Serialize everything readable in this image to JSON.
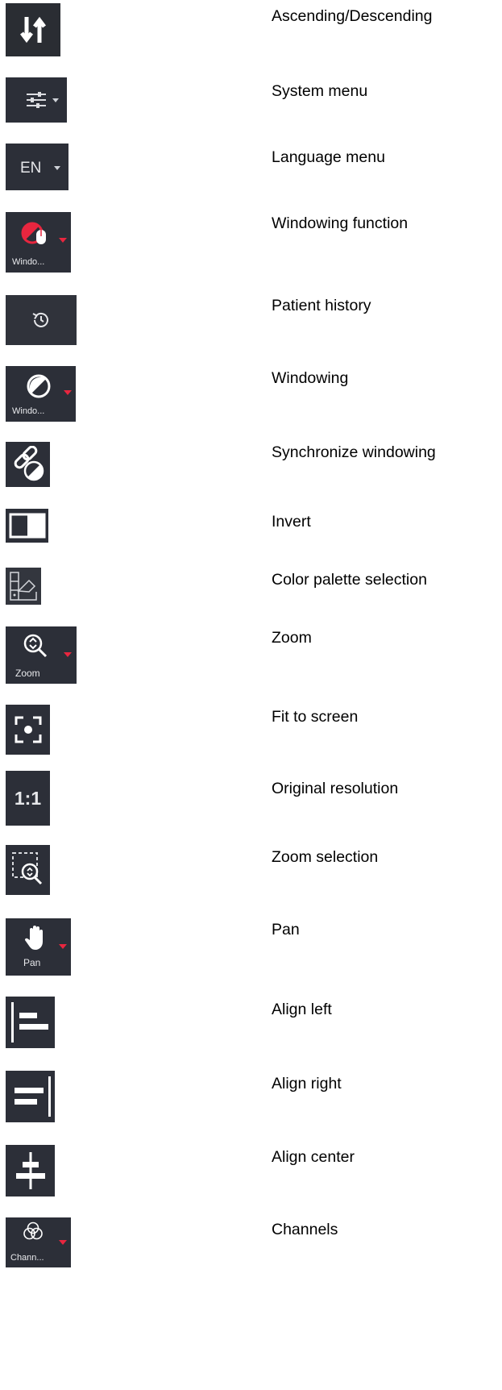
{
  "rows": [
    {
      "icon": "sort-arrows-icon",
      "label": "Ascending/Descending"
    },
    {
      "icon": "sliders-icon",
      "label": "System menu"
    },
    {
      "icon": "language-icon",
      "label": "Language menu",
      "icon_text": "EN"
    },
    {
      "icon": "windowing-function-icon",
      "label": "Windowing function",
      "icon_text": "Windo..."
    },
    {
      "icon": "history-icon",
      "label": "Patient history"
    },
    {
      "icon": "windowing-icon",
      "label": "Windowing",
      "icon_text": "Windo..."
    },
    {
      "icon": "sync-link-icon",
      "label": "Synchronize windowing"
    },
    {
      "icon": "invert-icon",
      "label": "Invert"
    },
    {
      "icon": "palette-icon",
      "label": "Color palette selection"
    },
    {
      "icon": "zoom-icon",
      "label": "Zoom",
      "icon_text": "Zoom"
    },
    {
      "icon": "fit-screen-icon",
      "label": "Fit to screen"
    },
    {
      "icon": "one-to-one-icon",
      "label": "Original resolution",
      "icon_text": "1:1"
    },
    {
      "icon": "zoom-selection-icon",
      "label": "Zoom selection"
    },
    {
      "icon": "hand-icon",
      "label": "Pan",
      "icon_text": "Pan"
    },
    {
      "icon": "align-left-icon",
      "label": "Align left"
    },
    {
      "icon": "align-right-icon",
      "label": "Align right"
    },
    {
      "icon": "align-center-icon",
      "label": "Align center"
    },
    {
      "icon": "channels-icon",
      "label": "Channels",
      "icon_text": "Chann..."
    }
  ],
  "colors": {
    "icon_bg": "#2c2f38",
    "accent_red": "#e8263f",
    "icon_fg": "#ffffff"
  }
}
